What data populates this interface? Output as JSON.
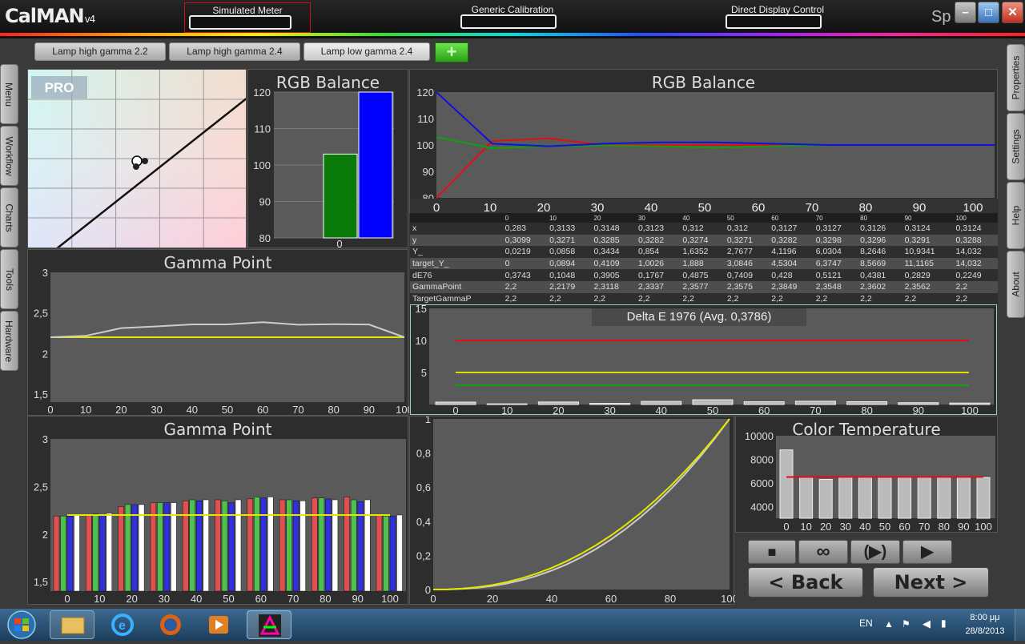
{
  "app": {
    "logo": "CalMAN",
    "logo_sup": "v4",
    "right_text": "Sp"
  },
  "connections": [
    {
      "label": "Simulated Meter"
    },
    {
      "label": "Generic Calibration DVD"
    },
    {
      "label": "Direct Display Control"
    }
  ],
  "workflow_tabs": [
    "Lamp high gamma 2.2",
    "Lamp high gamma 2.4",
    "Lamp low gamma 2.4"
  ],
  "add_tab_label": "+",
  "left_tabs": [
    "Menu",
    "Workflow",
    "Charts",
    "Tools",
    "Hardware"
  ],
  "right_tabs": [
    "Properties",
    "Settings",
    "Help",
    "About"
  ],
  "cie": {
    "badge": "PRO"
  },
  "rgb_bar": {
    "title": "RGB Balance",
    "xlabel": "0",
    "ylim": [
      80,
      120
    ],
    "yticks": [
      "80",
      "90",
      "100",
      "110",
      "120"
    ],
    "values": {
      "red": 80,
      "green": 103,
      "blue": 120
    },
    "colors": {
      "red": "#c00000",
      "green": "#0a7a0a",
      "blue": "#0000ff"
    }
  },
  "rgb_line": {
    "title": "RGB Balance",
    "x": [
      0,
      10,
      20,
      30,
      40,
      50,
      60,
      70,
      80,
      90,
      100
    ],
    "xticks": [
      "0",
      "10",
      "20",
      "30",
      "40",
      "50",
      "60",
      "70",
      "80",
      "90",
      "100"
    ],
    "yticks": [
      "80",
      "90",
      "100",
      "110",
      "120"
    ],
    "ylim": [
      80,
      120
    ],
    "series": [
      {
        "color": "#e01010",
        "values": [
          78,
          101.5,
          102.5,
          100,
          100,
          100,
          100,
          100,
          100,
          100,
          100
        ]
      },
      {
        "color": "#10a010",
        "values": [
          103,
          98.8,
          99.5,
          99.8,
          99.5,
          99,
          99.5,
          100,
          100,
          100,
          100
        ]
      },
      {
        "color": "#1010e0",
        "values": [
          120,
          100.5,
          99.5,
          100.5,
          101,
          101,
          100.5,
          100,
          100,
          100,
          100
        ]
      }
    ]
  },
  "table": {
    "header": [
      "",
      "0",
      "10",
      "20",
      "30",
      "40",
      "50",
      "60",
      "70",
      "80",
      "90",
      "100"
    ],
    "rows": [
      [
        "x",
        "0,283",
        "0,3133",
        "0,3148",
        "0,3123",
        "0,312",
        "0,312",
        "0,3127",
        "0,3127",
        "0,3126",
        "0,3124",
        "0,3124"
      ],
      [
        "y",
        "0,3099",
        "0,3271",
        "0,3285",
        "0,3282",
        "0,3274",
        "0,3271",
        "0,3282",
        "0,3298",
        "0,3296",
        "0,3291",
        "0,3288"
      ],
      [
        "Y_",
        "0,0219",
        "0,0858",
        "0,3434",
        "0,854",
        "1,6352",
        "2,7677",
        "4,1196",
        "6,0304",
        "8,2646",
        "10,9341",
        "14,032"
      ],
      [
        "target_Y_",
        "0",
        "0,0894",
        "0,4109",
        "1,0026",
        "1,888",
        "3,0846",
        "4,5304",
        "6,3747",
        "8,5669",
        "11,1165",
        "14,032"
      ],
      [
        "dE76",
        "0,3743",
        "0,1048",
        "0,3905",
        "0,1767",
        "0,4875",
        "0,7409",
        "0,428",
        "0,5121",
        "0,4381",
        "0,2829",
        "0,2249"
      ],
      [
        "GammaPoint",
        "2,2",
        "2,2179",
        "2,3118",
        "2,3337",
        "2,3577",
        "2,3575",
        "2,3849",
        "2,3548",
        "2,3602",
        "2,3562",
        "2,2"
      ],
      [
        "TargetGammaP",
        "2,2",
        "2,2",
        "2,2",
        "2,2",
        "2,2",
        "2,2",
        "2,2",
        "2,2",
        "2,2",
        "2,2",
        "2,2"
      ]
    ]
  },
  "deltae": {
    "title": "Delta E 1976 (Avg. 0,3786)",
    "ylim": [
      0,
      15
    ],
    "yticks": [
      "5",
      "10",
      "15"
    ],
    "xticks": [
      "0",
      "10",
      "20",
      "30",
      "40",
      "50",
      "60",
      "70",
      "80",
      "90",
      "100"
    ],
    "values": [
      0.3743,
      0.1048,
      0.3905,
      0.1767,
      0.4875,
      0.7409,
      0.428,
      0.5121,
      0.4381,
      0.2829,
      0.2249
    ],
    "thresholds": [
      {
        "value": 10,
        "color": "#e01010"
      },
      {
        "value": 5,
        "color": "#e0e000"
      },
      {
        "value": 3,
        "color": "#10a010"
      }
    ]
  },
  "gamma_line": {
    "title": "Gamma Point",
    "ylim": [
      1.4,
      3
    ],
    "yticks": [
      "1,5",
      "2",
      "2,5",
      "3"
    ],
    "xticks": [
      "0",
      "10",
      "20",
      "30",
      "40",
      "50",
      "60",
      "70",
      "80",
      "90",
      "100"
    ],
    "values": [
      2.2,
      2.2179,
      2.3118,
      2.3337,
      2.3577,
      2.3575,
      2.3849,
      2.3548,
      2.3602,
      2.3562,
      2.2
    ],
    "target": 2.2
  },
  "gamma_bars": {
    "title": "Gamma Point",
    "ylim": [
      1.4,
      3
    ],
    "yticks": [
      "1,5",
      "2",
      "2,5",
      "3"
    ],
    "xticks": [
      "0",
      "10",
      "20",
      "30",
      "40",
      "50",
      "60",
      "70",
      "80",
      "90",
      "100"
    ],
    "red": [
      2.19,
      2.2,
      2.29,
      2.33,
      2.35,
      2.36,
      2.37,
      2.36,
      2.38,
      2.39,
      2.2
    ],
    "green": [
      2.19,
      2.21,
      2.31,
      2.33,
      2.36,
      2.35,
      2.39,
      2.36,
      2.38,
      2.36,
      2.19
    ],
    "blue": [
      2.19,
      2.2,
      2.31,
      2.33,
      2.35,
      2.33,
      2.38,
      2.35,
      2.37,
      2.34,
      2.19
    ],
    "white": [
      2.2,
      2.22,
      2.31,
      2.33,
      2.36,
      2.36,
      2.39,
      2.35,
      2.36,
      2.36,
      2.2
    ],
    "target": 2.2
  },
  "eotf": {
    "xticks": [
      "0",
      "20",
      "40",
      "60",
      "80",
      "100"
    ],
    "yticks": [
      "0",
      "0,2",
      "0,4",
      "0,6",
      "0,8",
      "1"
    ]
  },
  "colortemp": {
    "title": "Color Temperature",
    "ylim": [
      3000,
      10000
    ],
    "yticks": [
      "4000",
      "6000",
      "8000",
      "10000"
    ],
    "xticks": [
      "0",
      "10",
      "20",
      "30",
      "40",
      "50",
      "60",
      "70",
      "80",
      "90",
      "100"
    ],
    "values": [
      8800,
      6500,
      6300,
      6450,
      6450,
      6480,
      6450,
      6450,
      6450,
      6450,
      6450
    ],
    "target": 6504
  },
  "controls": {
    "stop": "■",
    "loop": "∞",
    "play_step": "(▶)",
    "play": "▶",
    "back": "< Back",
    "next": "Next >"
  },
  "taskbar": {
    "lang": "EN",
    "time": "8:00 μμ",
    "date": "28/8/2013"
  }
}
